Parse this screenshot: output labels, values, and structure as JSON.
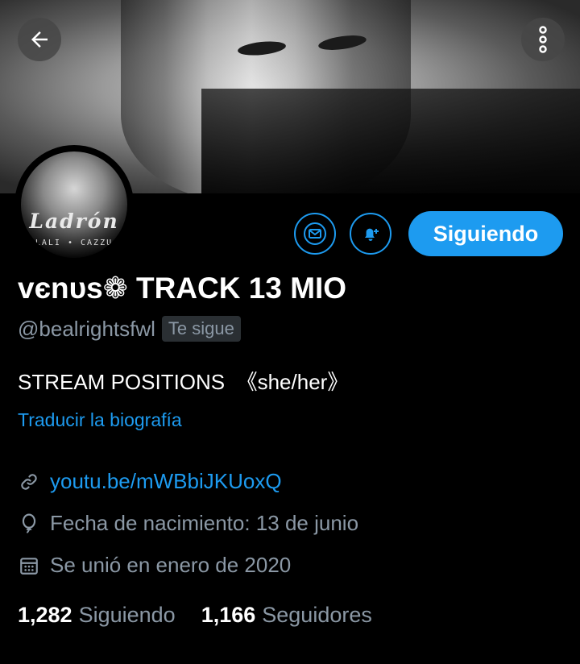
{
  "header": {
    "back_icon": "arrow-left-icon",
    "more_icon": "more-vertical-icon"
  },
  "avatar": {
    "title": "Ladrón",
    "subtitle": "LALI • CAZZU"
  },
  "actions": {
    "message_icon": "mail-icon",
    "notify_icon": "bell-plus-icon",
    "follow_label": "Siguiendo"
  },
  "profile": {
    "display_name": "vєnυs❁ TRACK 13 MIO",
    "handle": "@bealrightsfwl",
    "follows_you": "Te sigue",
    "bio": "STREAM POSITIONS  《she/her》",
    "translate": "Traducir la biografía",
    "link": "youtu.be/mWBbiJKUoxQ",
    "birthday": "Fecha de nacimiento: 13 de junio",
    "joined": "Se unió en enero de 2020"
  },
  "stats": {
    "following_count": "1,282",
    "following_label": "Siguiendo",
    "followers_count": "1,166",
    "followers_label": "Seguidores"
  },
  "colors": {
    "accent": "#1d9bf0",
    "secondary_text": "#8b98a5",
    "background": "#000000"
  }
}
